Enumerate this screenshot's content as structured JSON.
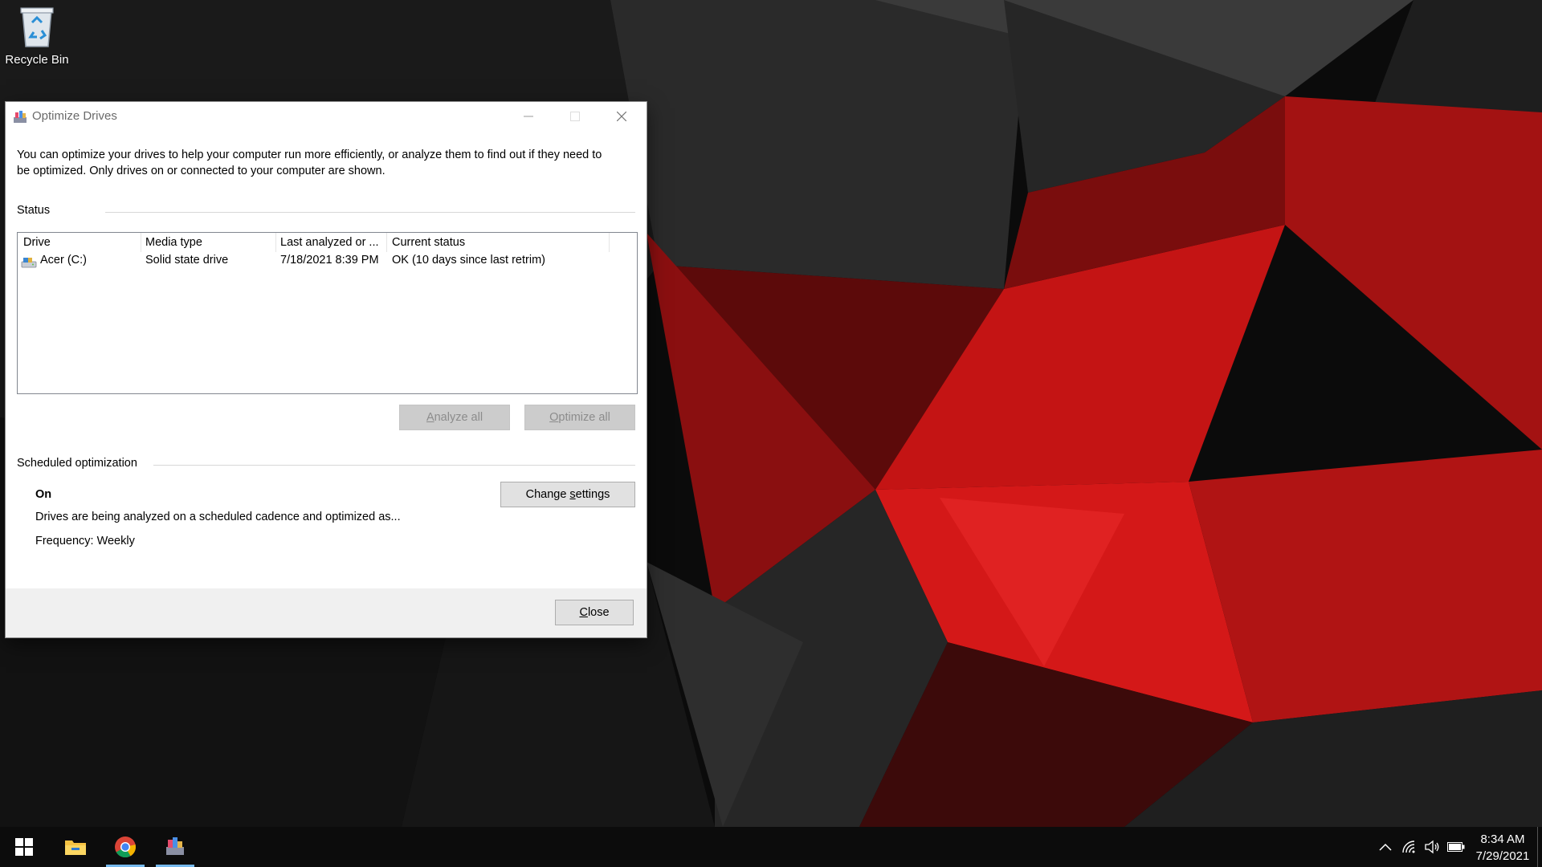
{
  "desktop": {
    "icons": [
      {
        "label": "Recycle Bin",
        "icon": "recycle-bin-icon"
      }
    ]
  },
  "window": {
    "title": "Optimize Drives",
    "description": "You can optimize your drives to help your computer run more efficiently, or analyze them to find out if they need to be optimized. Only drives on or connected to your computer are shown.",
    "status_label": "Status",
    "columns": [
      "Drive",
      "Media type",
      "Last analyzed or ...",
      "Current status"
    ],
    "drives": [
      {
        "drive": "Acer (C:)",
        "media_type": "Solid state drive",
        "last_analyzed": "7/18/2021 8:39 PM",
        "current_status": "OK (10 days since last retrim)"
      }
    ],
    "analyze_all": {
      "accel": "A",
      "rest": "nalyze all"
    },
    "optimize_all": {
      "accel": "O",
      "rest": "ptimize all"
    },
    "scheduled_label": "Scheduled optimization",
    "schedule_state": "On",
    "schedule_description": "Drives are being analyzed on a scheduled cadence and optimized as...",
    "frequency": "Frequency: Weekly",
    "change_settings": {
      "before": "Change ",
      "accel": "s",
      "after": "ettings"
    },
    "close": {
      "accel": "C",
      "rest": "lose"
    }
  },
  "taskbar": {
    "apps": [
      "start-icon",
      "file-explorer-icon",
      "chrome-icon",
      "optimize-drives-icon"
    ],
    "time": "8:34 AM",
    "date": "7/29/2021",
    "accent_color": "#76b9ed"
  }
}
